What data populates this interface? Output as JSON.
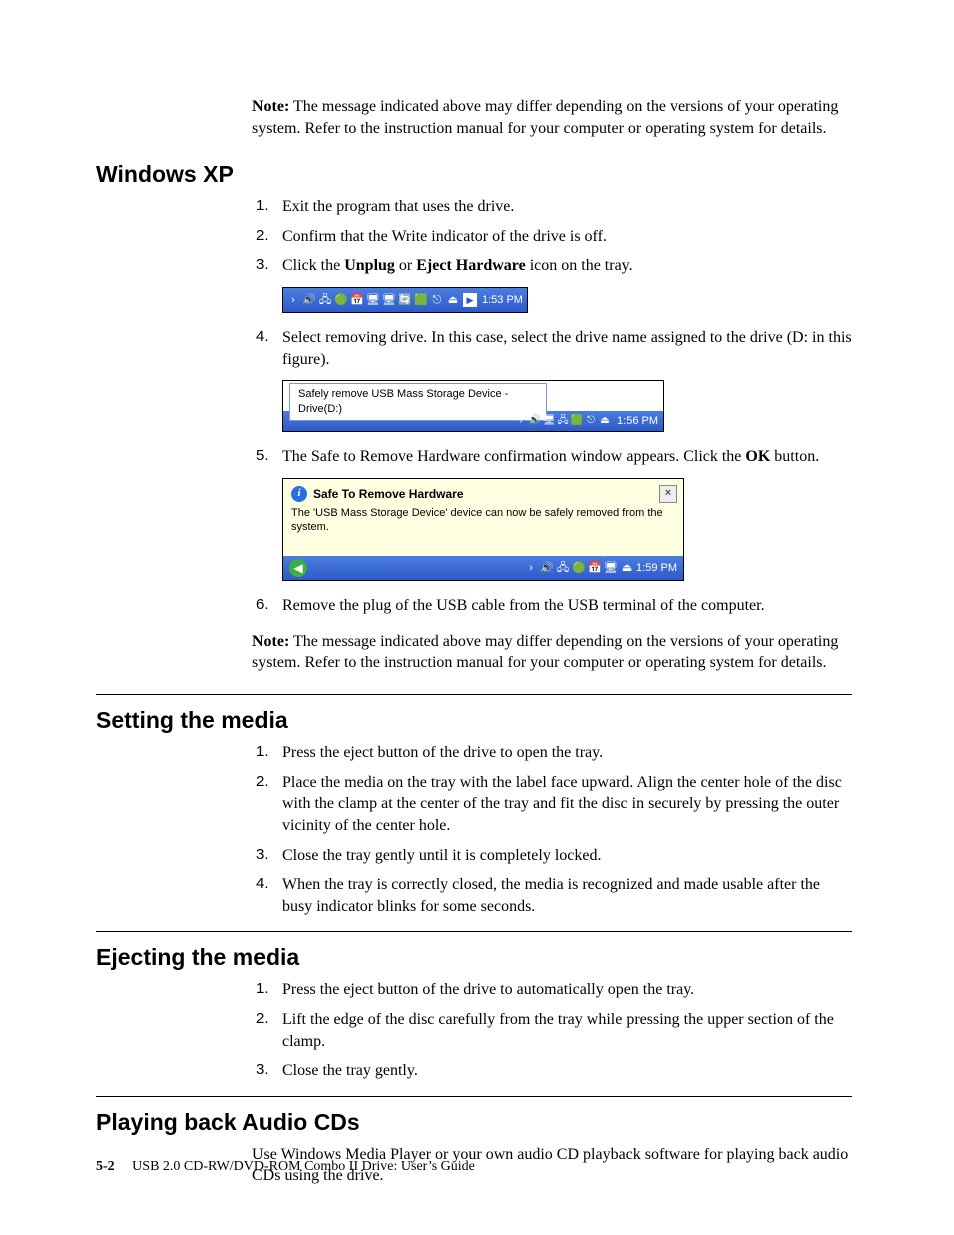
{
  "note_label": "Note:",
  "intro_note": "The message indicated above may differ depending on the versions of your operating system. Refer to the instruction manual for your computer or operating system for details.",
  "winxp": {
    "heading": "Windows XP",
    "step1": "Exit the program that uses the drive.",
    "step2": "Confirm that the Write indicator of the drive is off.",
    "step3_a": "Click the ",
    "step3_b": "Unplug",
    "step3_c": " or ",
    "step3_d": "Eject Hardware",
    "step3_e": " icon on the tray.",
    "step4": "Select removing drive. In this case, select the drive name assigned to the drive (D: in this figure).",
    "step5_a": "The Safe to Remove Hardware confirmation window appears. Click the ",
    "step5_b": "OK",
    "step5_c": " button.",
    "step6": "Remove the plug of the USB cable from the USB terminal of the computer."
  },
  "tray1_time": "1:53 PM",
  "tray2": {
    "menu_text": "Safely remove USB Mass Storage Device - Drive(D:)",
    "time": "1:56 PM"
  },
  "balloon": {
    "title": "Safe To Remove Hardware",
    "body": "The 'USB Mass Storage Device' device can now be safely removed from the system.",
    "time": "1:59 PM"
  },
  "post_note": "The message indicated above may differ depending on the versions of your operating system. Refer to the instruction manual for your computer or operating system for details.",
  "setting": {
    "heading": "Setting the media",
    "s1": "Press the eject button of the drive to open the tray.",
    "s2": "Place the media on the tray with the label face upward. Align the center hole of the disc with the clamp at the center of the tray and fit the disc in securely by pressing the outer vicinity of the center hole.",
    "s3": "Close the tray gently until it is completely locked.",
    "s4": "When the tray is correctly closed, the media is recognized and made usable after the busy indicator blinks for some seconds."
  },
  "ejecting": {
    "heading": "Ejecting the media",
    "s1": "Press the eject button of the drive to automatically open the tray.",
    "s2": "Lift the edge of the disc carefully from the tray while pressing the upper section of the clamp.",
    "s3": "Close the tray gently."
  },
  "playing": {
    "heading": "Playing back Audio CDs",
    "body": "Use Windows Media Player or your own audio CD playback software for playing back audio CDs using the drive."
  },
  "footer": {
    "page": "5-2",
    "title": "USB 2.0 CD-RW/DVD-ROM Combo II Drive: User’s Guide"
  }
}
